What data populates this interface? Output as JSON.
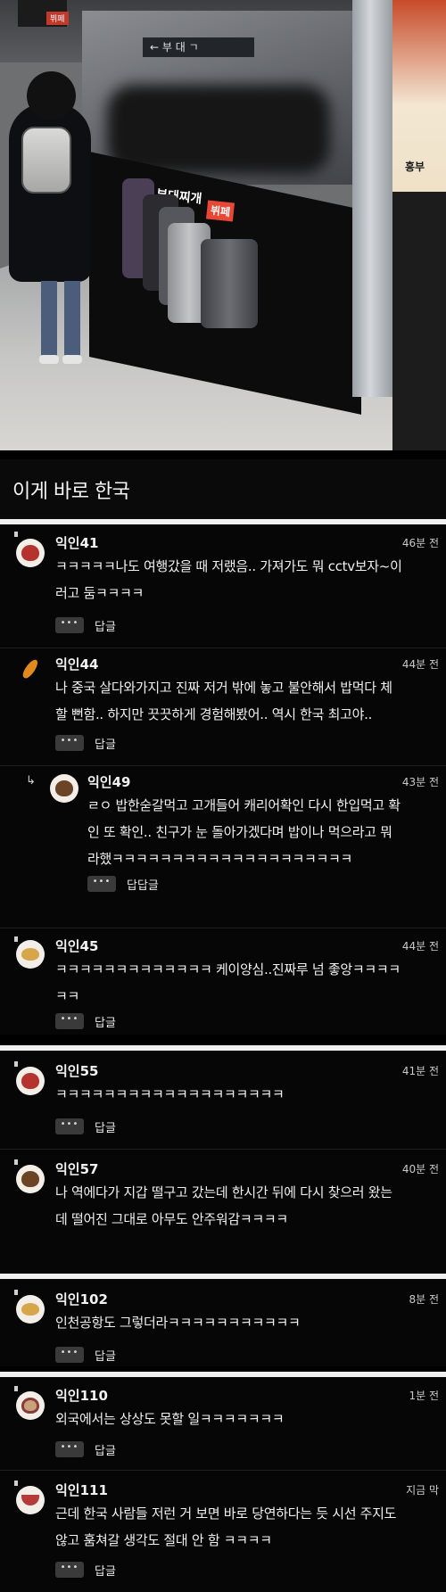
{
  "photo": {
    "sign_text": "← 부 대 ㄱ",
    "shop_name": "부대찌개",
    "shop_tag": "뷔페",
    "poster_text": "흥부",
    "brand_tag": "뷔페"
  },
  "post": {
    "title": "이게 바로 한국"
  },
  "comments": [
    {
      "author": "익인41",
      "time": "46분 전",
      "lines": [
        "ㅋㅋㅋㅋㅋ나도 여행갔을 때 저랬음.. 가져가도 뭐 cctv보자~이",
        "러고 둠ㅋㅋㅋㅋ"
      ],
      "reply_label": "답글",
      "more_label": "•••",
      "avatar": "squid-avatar-icon"
    },
    {
      "author": "익인44",
      "time": "44분 전",
      "lines": [
        "나 중국 살다와가지고 진짜 저거 밖에 놓고 불안해서 밥먹다 체",
        "할 뻔함.. 하지만 끗끗하게 경험해봤어.. 역시 한국 최고야.."
      ],
      "reply_label": "답글",
      "more_label": "•••",
      "avatar": "fried-shrimp-avatar-icon"
    },
    {
      "author": "익인49",
      "time": "43분 전",
      "lines": [
        "ㄹㅇ 밥한숟갈먹고 고개들어 캐리어확인 다시 한입먹고 확",
        "인 또 확인.. 친구가 눈 돌아가겠다며 밥이나 먹으라고 뭐",
        "라했ㅋㅋㅋㅋㅋㅋㅋㅋㅋㅋㅋㅋㅋㅋㅋㅋㅋㅋㅋㅋ"
      ],
      "reply_label": "답답글",
      "more_label": "•••",
      "avatar": "bread-avatar-icon"
    },
    {
      "author": "익인45",
      "time": "44분 전",
      "lines": [
        "ㅋㅋㅋㅋㅋㅋㅋㅋㅋㅋㅋㅋㅋ 케이양심..진짜루 넘 좋앙ㅋㅋㅋㅋ",
        "ㅋㅋ"
      ],
      "reply_label": "답글",
      "more_label": "•••",
      "avatar": "dumpling-avatar-icon"
    },
    {
      "author": "익인55",
      "time": "41분 전",
      "lines": [
        "ㅋㅋㅋㅋㅋㅋㅋㅋㅋㅋㅋㅋㅋㅋㅋㅋㅋㅋㅋ"
      ],
      "reply_label": "답글",
      "more_label": "•••",
      "avatar": "squid-avatar-icon"
    },
    {
      "author": "익인57",
      "time": "40분 전",
      "lines": [
        "나 역에다가 지갑 떨구고 갔는데 한시간 뒤에 다시 찾으러 왔는",
        "데 떨어진 그대로 아무도 안주워감ㅋㅋㅋㅋ"
      ],
      "reply_label": "답글",
      "more_label": "•••",
      "avatar": "bread-avatar-icon"
    },
    {
      "author": "익인102",
      "time": "8분 전",
      "lines": [
        "인천공항도 그렇더라ㅋㅋㅋㅋㅋㅋㅋㅋㅋㅋㅋ"
      ],
      "reply_label": "답글",
      "more_label": "•••",
      "avatar": "dumpling-avatar-icon"
    },
    {
      "author": "익인110",
      "time": "1분 전",
      "lines": [
        "외국에서는 상상도 못할 일ㅋㅋㅋㅋㅋㅋㅋ"
      ],
      "reply_label": "답글",
      "more_label": "•••",
      "avatar": "cookie-avatar-icon"
    },
    {
      "author": "익인111",
      "time": "지금 막",
      "lines": [
        "근데 한국 사람들 저런 거 보면 바로 당연하다는 듯 시선 주지도",
        "않고 훔쳐갈 생각도 절대 안 함 ㅋㅋㅋㅋ"
      ],
      "reply_label": "답글",
      "more_label": "•••",
      "avatar": "rice-bowl-avatar-icon"
    }
  ]
}
